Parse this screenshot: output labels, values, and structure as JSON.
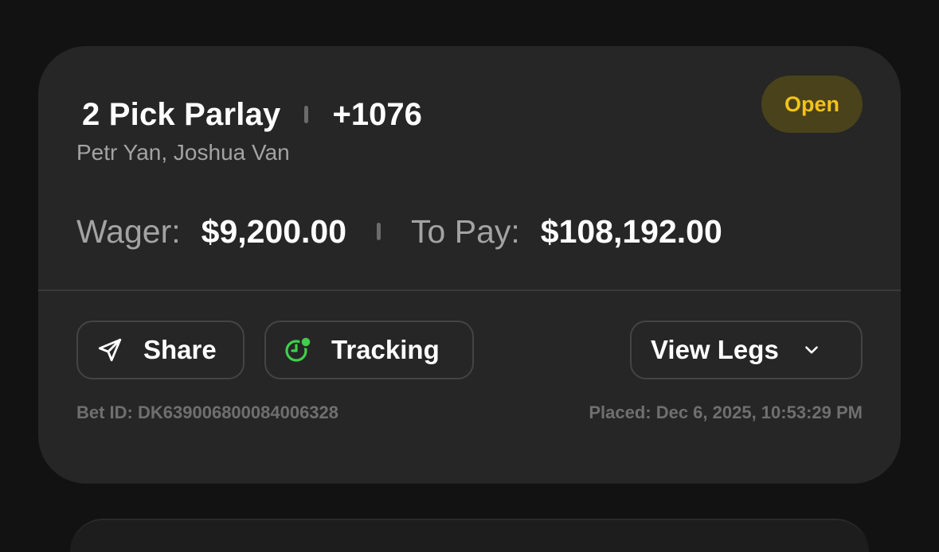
{
  "bet": {
    "title": "2 Pick Parlay",
    "odds": "+1076",
    "selections": "Petr Yan, Joshua Van",
    "status": "Open",
    "wager_label": "Wager:",
    "wager_value": "$9,200.00",
    "to_pay_label": "To Pay:",
    "to_pay_value": "$108,192.00"
  },
  "actions": {
    "share_label": "Share",
    "tracking_label": "Tracking",
    "view_legs_label": "View Legs"
  },
  "footer": {
    "bet_id": "Bet ID: DK639006800084006328",
    "placed": "Placed: Dec 6, 2025, 10:53:29 PM"
  },
  "icons": {
    "share": "send-icon",
    "tracking": "clock-icon",
    "view_legs": "chevron-down-icon"
  },
  "colors": {
    "background": "#121212",
    "card": "#262626",
    "status_text": "#f2c318",
    "status_bg": "#4a421b",
    "tracking_icon": "#3fcf4a",
    "muted_text": "#a3a3a3"
  }
}
